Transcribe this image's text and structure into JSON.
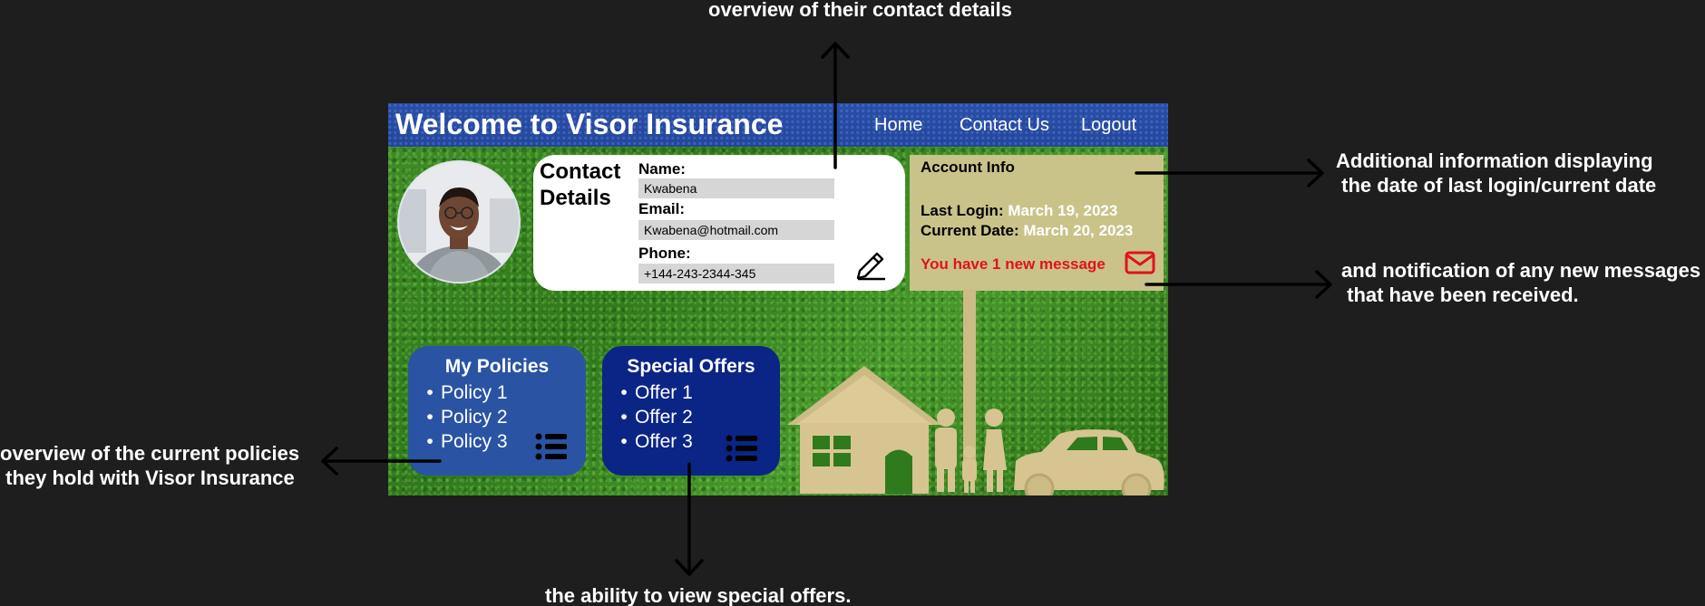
{
  "annotations": {
    "top": "overview of their contact details",
    "right_upper": "Additional information displaying\n the date of last login/current date",
    "right_lower": "and notification of any new messages\n that have been received.",
    "left": "overview of the current policies\n they hold with Visor Insurance",
    "bottom": "the ability to view special offers."
  },
  "header": {
    "title": "Welcome to Visor Insurance",
    "nav": [
      "Home",
      "Contact Us",
      "Logout"
    ]
  },
  "contact": {
    "title": "Contact Details",
    "name_label": "Name:",
    "name_value": "Kwabena",
    "email_label": "Email:",
    "email_value": "Kwabena@hotmail.com",
    "phone_label": "Phone:",
    "phone_value": "+144-243-2344-345"
  },
  "account": {
    "title": "Account Info",
    "last_login_label": "Last Login:",
    "last_login_value": "March 19, 2023",
    "current_date_label": "Current Date:",
    "current_date_value": "March 20, 2023",
    "message": "You have 1 new message"
  },
  "policies": {
    "title": "My Policies",
    "items": [
      "Policy 1",
      "Policy 2",
      "Policy 3"
    ]
  },
  "offers": {
    "title": "Special Offers",
    "items": [
      "Offer 1",
      "Offer 2",
      "Offer 3"
    ]
  },
  "colors": {
    "page_background": "#1e1e1e",
    "header_bar": "#24469a",
    "policies_panel": "#2a54a3",
    "offers_panel": "#0a2585",
    "account_panel": "#c9c38a",
    "message_red": "#e3121a",
    "grass": "#3a8a26"
  },
  "icons": [
    "avatar-photo",
    "pencil-edit-icon",
    "mail-icon",
    "list-icon",
    "house-family-car-illustration"
  ]
}
